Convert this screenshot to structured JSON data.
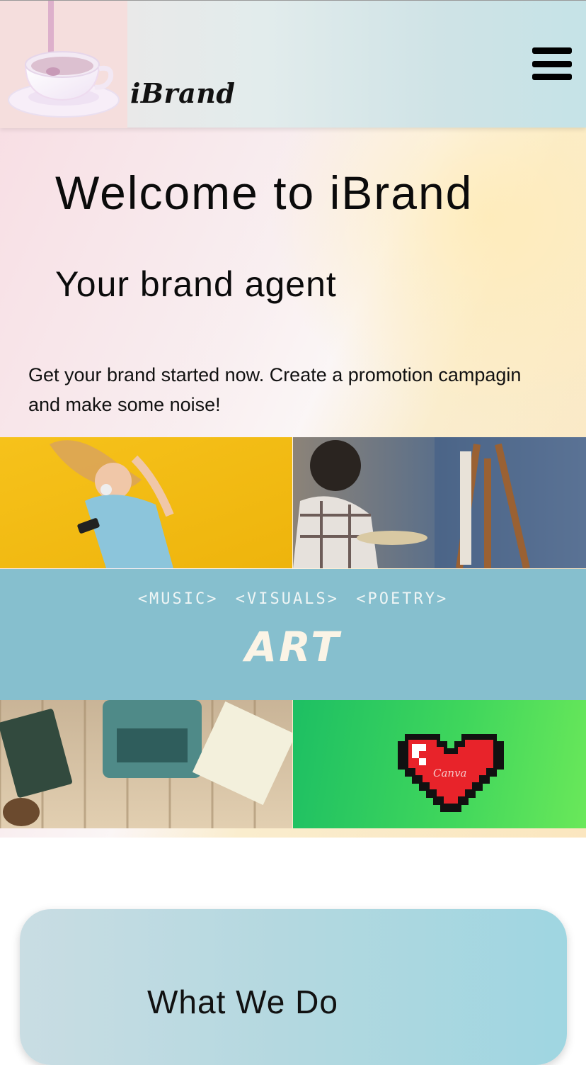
{
  "header": {
    "brand_name": "iBrand",
    "logo_icon": "teacup-logo-icon",
    "menu_icon": "hamburger-menu-icon"
  },
  "hero": {
    "title": "Welcome to iBrand",
    "subtitle": "Your brand agent",
    "text": "Get your brand started now. Create a promotion campagin and make some noise!"
  },
  "collage": {
    "tags": "<MUSIC> <VISUALS> <POETRY>",
    "word": "ART",
    "heart_label": "Canva",
    "tiles": [
      "music-photo",
      "painter-photo",
      "typewriter-photo",
      "pixel-heart-graphic"
    ]
  },
  "section": {
    "title": "What We Do"
  },
  "colors": {
    "banner": "#86bfce",
    "card_start": "#c9dde3",
    "card_end": "#9fd6e1"
  }
}
